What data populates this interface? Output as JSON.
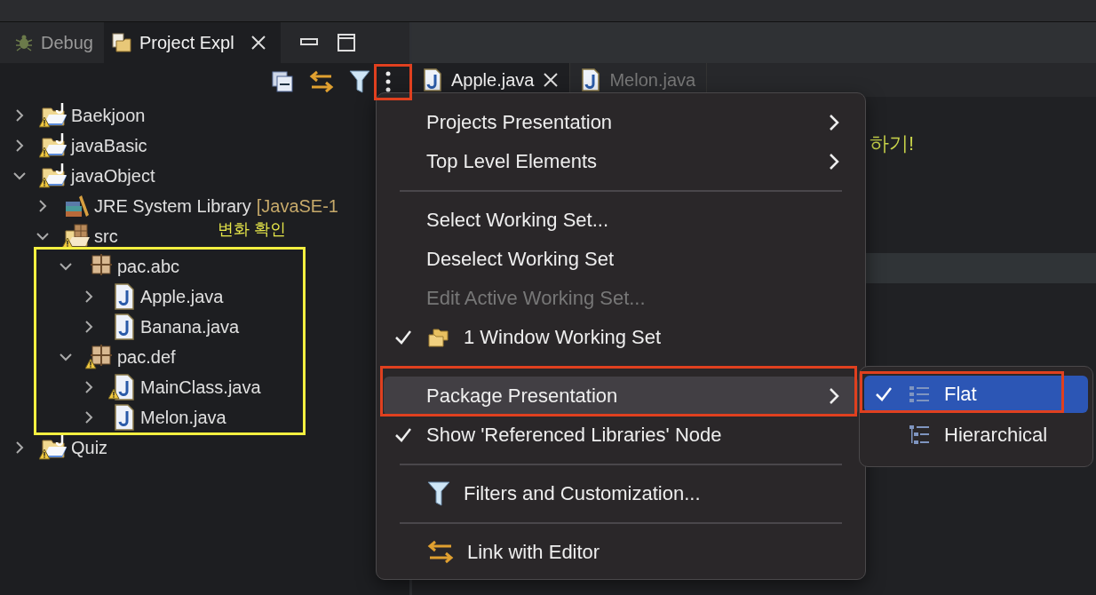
{
  "view_tabs": [
    {
      "label": "Debug",
      "selected": false
    },
    {
      "label": "Project Expl",
      "selected": true
    }
  ],
  "tree": [
    {
      "label": "Baekjoon",
      "kind": "project",
      "warning": true,
      "expanded": false
    },
    {
      "label": "javaBasic",
      "kind": "project",
      "warning": true,
      "expanded": false
    },
    {
      "label": "javaObject",
      "kind": "project",
      "warning": true,
      "expanded": true,
      "children": [
        {
          "label": "JRE System Library",
          "decoration": "[JavaSE-1",
          "kind": "library",
          "warning": false,
          "expanded": false
        },
        {
          "label": "src",
          "kind": "source-folder",
          "warning": true,
          "expanded": true,
          "children": [
            {
              "label": "pac.abc",
              "kind": "package",
              "warning": false,
              "expanded": true,
              "children": [
                {
                  "label": "Apple.java",
                  "kind": "java-file",
                  "warning": false,
                  "expanded": false
                },
                {
                  "label": "Banana.java",
                  "kind": "java-file",
                  "warning": false,
                  "expanded": false
                }
              ]
            },
            {
              "label": "pac.def",
              "kind": "package",
              "warning": true,
              "expanded": true,
              "children": [
                {
                  "label": "MainClass.java",
                  "kind": "java-file",
                  "warning": true,
                  "expanded": false
                },
                {
                  "label": "Melon.java",
                  "kind": "java-file",
                  "warning": false,
                  "expanded": false
                }
              ]
            }
          ]
        }
      ]
    },
    {
      "label": "Quiz",
      "kind": "project",
      "warning": true,
      "expanded": false
    }
  ],
  "annotation": {
    "text": "변화 확인"
  },
  "editor_tabs": [
    {
      "label": "Apple.java",
      "selected": true
    },
    {
      "label": "Melon.java",
      "selected": false
    }
  ],
  "editor": {
    "text": "하기!"
  },
  "menu": [
    {
      "kind": "plain",
      "label": "Projects Presentation",
      "checked": false,
      "disabled": false,
      "submenu": true,
      "selected": false
    },
    {
      "kind": "plain",
      "label": "Top Level Elements",
      "checked": false,
      "disabled": false,
      "submenu": true,
      "selected": false
    },
    {
      "kind": "separator"
    },
    {
      "kind": "plain",
      "label": "Select Working Set...",
      "checked": false,
      "disabled": false,
      "submenu": false,
      "selected": false
    },
    {
      "kind": "plain",
      "label": "Deselect Working Set",
      "checked": false,
      "disabled": false,
      "submenu": false,
      "selected": false
    },
    {
      "kind": "plain",
      "label": "Edit Active Working Set...",
      "checked": false,
      "disabled": true,
      "submenu": false,
      "selected": false
    },
    {
      "kind": "working-set",
      "label": "1 Window Working Set",
      "checked": true,
      "disabled": false,
      "submenu": false,
      "selected": false
    },
    {
      "kind": "separator"
    },
    {
      "kind": "plain",
      "label": "Package Presentation",
      "checked": false,
      "disabled": false,
      "submenu": true,
      "selected": true
    },
    {
      "kind": "plain",
      "label": "Show 'Referenced Libraries' Node",
      "checked": true,
      "disabled": false,
      "submenu": false,
      "selected": false
    },
    {
      "kind": "separator"
    },
    {
      "kind": "filter",
      "label": "Filters and Customization...",
      "checked": false,
      "disabled": false,
      "submenu": false,
      "selected": false
    },
    {
      "kind": "separator"
    },
    {
      "kind": "link",
      "label": "Link with Editor",
      "checked": false,
      "disabled": false,
      "submenu": false,
      "selected": false
    }
  ],
  "submenu": [
    {
      "kind": "flat",
      "label": "Flat",
      "checked": true,
      "selected": true
    },
    {
      "kind": "hierarchical",
      "label": "Hierarchical",
      "checked": false,
      "selected": false
    }
  ]
}
